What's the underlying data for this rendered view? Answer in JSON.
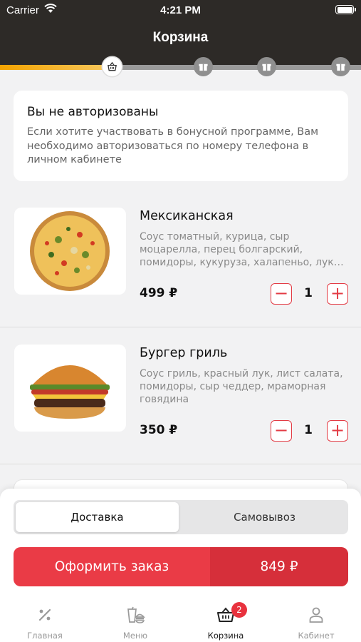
{
  "status_bar": {
    "carrier": "Carrier",
    "time": "4:21 PM"
  },
  "header": {
    "title": "Корзина"
  },
  "progress": {
    "fraction": 0.31,
    "steps": 4,
    "active_step": 1,
    "step_icons": [
      "basket-icon",
      "gift-icon",
      "gift-icon",
      "gift-icon"
    ]
  },
  "auth_notice": {
    "title": "Вы не авторизованы",
    "text": "Если хотите участвовать в бонусной программе, Вам необходимо авторизоваться по номеру телефона в личном кабинете"
  },
  "cart_items": [
    {
      "name": "Мексиканская",
      "description": "Соус томатный, курица, сыр моцарелла, перец болгарский, помидоры, кукуруза, халапеньо, лук…",
      "price": "499 ₽",
      "quantity": "1",
      "image": "pizza-image"
    },
    {
      "name": "Бургер гриль",
      "description": "Соус гриль, красный лук, лист салата, помидоры, сыр чеддер, мраморная говядина",
      "price": "350 ₽",
      "quantity": "1",
      "image": "burger-image"
    }
  ],
  "qty_controls": {
    "minus": "−",
    "plus": "+"
  },
  "delivery": {
    "options": [
      "Доставка",
      "Самовывоз"
    ],
    "selected": "Доставка"
  },
  "checkout": {
    "label": "Оформить заказ",
    "total": "849 ₽"
  },
  "tabbar": {
    "items": [
      {
        "label": "Главная",
        "icon": "percent-icon"
      },
      {
        "label": "Меню",
        "icon": "menu-food-icon"
      },
      {
        "label": "Корзина",
        "icon": "basket-icon",
        "badge": "2"
      },
      {
        "label": "Кабинет",
        "icon": "user-icon"
      }
    ],
    "active": "Корзина"
  },
  "colors": {
    "header": "#2d2a27",
    "accent": "#ea3b46",
    "progress": "#f4a300"
  }
}
